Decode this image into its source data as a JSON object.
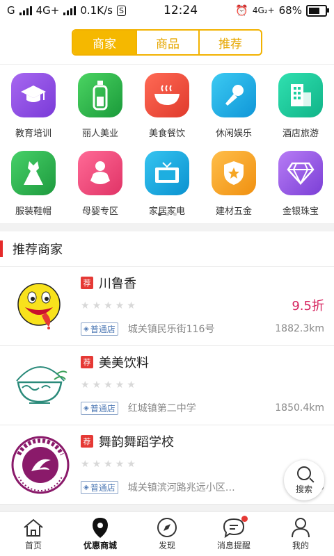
{
  "status_bar": {
    "carrier": "G",
    "network": "4G+",
    "speed": "0.1K/s",
    "speed_icon": "S",
    "time": "12:24",
    "right_network": "4G₂+",
    "battery": "68%",
    "battery_level": 0.68
  },
  "tabs": [
    {
      "label": "商家",
      "active": true
    },
    {
      "label": "商品",
      "active": false
    },
    {
      "label": "推荐",
      "active": false
    }
  ],
  "categories": [
    {
      "label": "教育培训",
      "icon": "graduation-cap-icon",
      "color": "#8a4ee0"
    },
    {
      "label": "丽人美业",
      "icon": "bottle-icon",
      "color": "#2db84a"
    },
    {
      "label": "美食餐饮",
      "icon": "bowl-icon",
      "color": "#ef4a3b"
    },
    {
      "label": "休闲娱乐",
      "icon": "microphone-icon",
      "color": "#1ab0e8"
    },
    {
      "label": "酒店旅游",
      "icon": "building-icon",
      "color": "#1ccfa0"
    },
    {
      "label": "服装鞋帽",
      "icon": "dress-icon",
      "color": "#2fbf54"
    },
    {
      "label": "母婴专区",
      "icon": "baby-icon",
      "color": "#f04a7a"
    },
    {
      "label": "家居家电",
      "icon": "tv-icon",
      "color": "#1eaee0"
    },
    {
      "label": "建材五金",
      "icon": "shield-star-icon",
      "color": "#f6a623"
    },
    {
      "label": "金银珠宝",
      "icon": "diamond-icon",
      "color": "#9b5be6"
    }
  ],
  "page_dots": 3,
  "section_title": "推荐商家",
  "merchants": [
    {
      "tag": "荐",
      "name": "川鲁香",
      "badge": "普通店",
      "address": "城关镇民乐街116号",
      "distance": "1882.3km",
      "discount": "9.5折",
      "logo": "smiley-logo"
    },
    {
      "tag": "荐",
      "name": "美美饮料",
      "badge": "普通店",
      "address": "红城镇第二中学",
      "distance": "1850.4km",
      "discount": "",
      "logo": "tea-bowl-logo"
    },
    {
      "tag": "荐",
      "name": "舞韵舞蹈学校",
      "badge": "普通店",
      "address": "城关镇滨河路兆远小区…",
      "distance": "263",
      "discount": "",
      "logo": "dance-school-logo"
    }
  ],
  "search_fab": {
    "label": "搜索",
    "icon": "search-icon"
  },
  "bottom_nav": [
    {
      "label": "首页",
      "icon": "home-icon",
      "active": false
    },
    {
      "label": "优惠商城",
      "icon": "location-pin-icon",
      "active": true
    },
    {
      "label": "发现",
      "icon": "compass-icon",
      "active": false
    },
    {
      "label": "消息提醒",
      "icon": "chat-bubble-icon",
      "active": false,
      "dot": true
    },
    {
      "label": "我的",
      "icon": "user-icon",
      "active": false
    }
  ],
  "colors": {
    "accent": "#f5b800",
    "tag_red": "#e53935",
    "discount": "#d6245f",
    "section_bar": "#e52a2a"
  }
}
